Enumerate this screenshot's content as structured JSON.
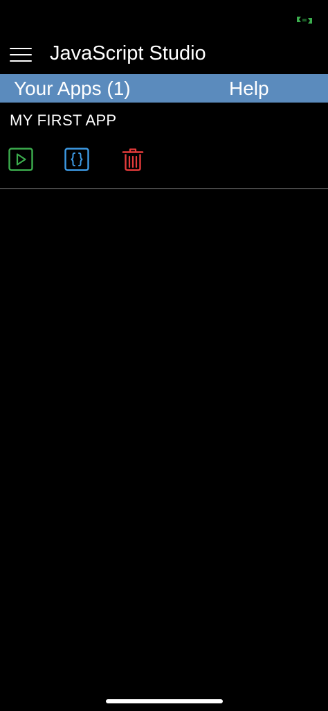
{
  "app": {
    "title": "JavaScript Studio"
  },
  "tabs": [
    {
      "label": "Your Apps (1)"
    },
    {
      "label": "Help"
    }
  ],
  "apps": [
    {
      "name": "MY FIRST APP",
      "actions": [
        {
          "icon": "play-icon",
          "color": "#3cae4e"
        },
        {
          "icon": "code-braces-icon",
          "color": "#3d9be6"
        },
        {
          "icon": "trash-icon",
          "color": "#e53b3b"
        }
      ]
    }
  ],
  "colors": {
    "background": "#000000",
    "tab_bar": "#5b8bbd",
    "text": "#ffffff",
    "status_icon": "#3cae4e"
  }
}
